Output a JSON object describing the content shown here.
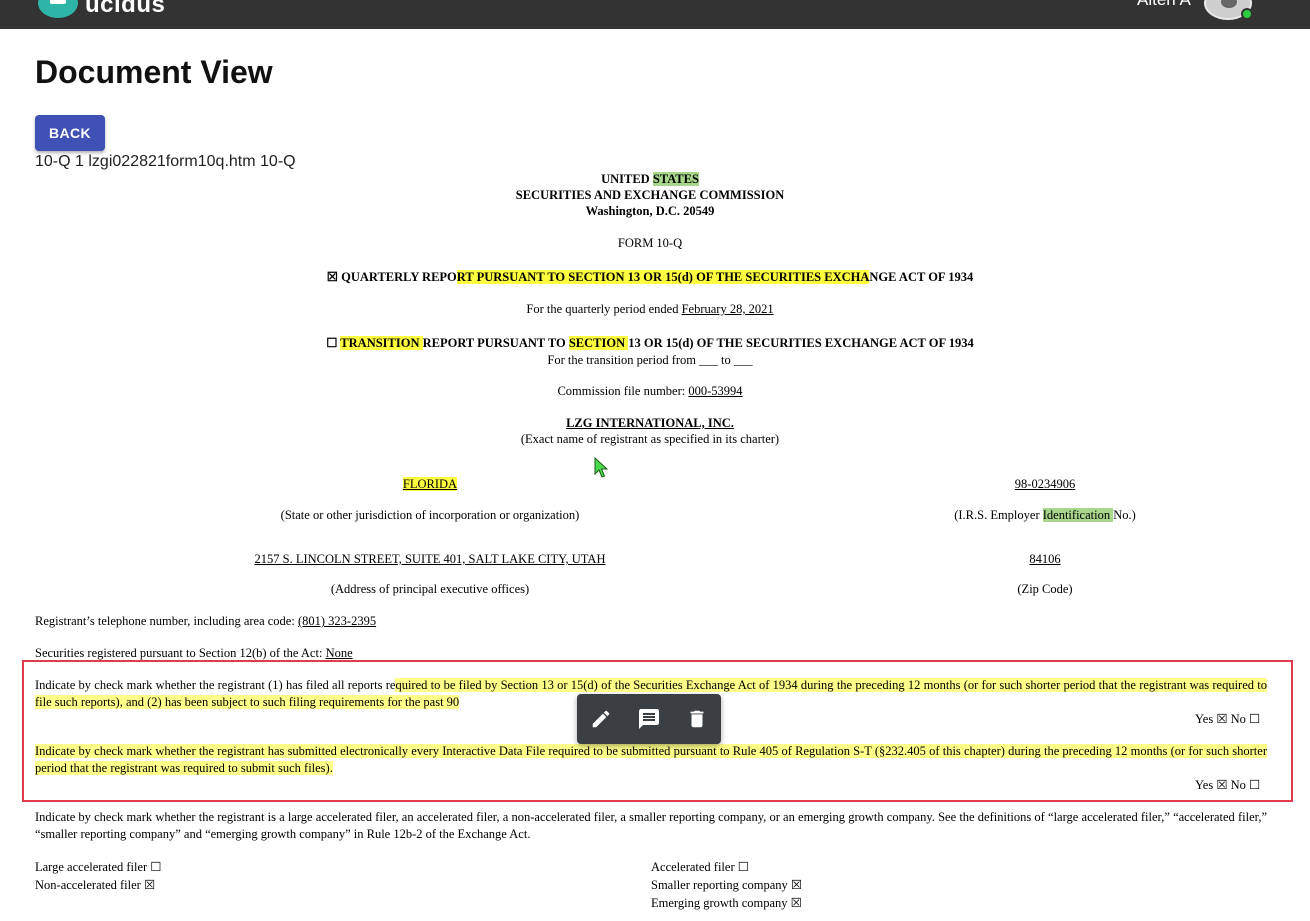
{
  "app": {
    "name": "ucidus",
    "user_name": "Aiten A"
  },
  "page": {
    "title": "Document View",
    "back_label": "BACK",
    "doc_heading": "10-Q 1 lzgi022821form10q.htm 10-Q"
  },
  "colors": {
    "appbar": "#333333",
    "accent": "#3f51b5",
    "highlight_yellow": "#ffff40",
    "highlight_green": "#a8d68b",
    "selection_border": "#e23b4e"
  },
  "document": {
    "header": {
      "line1_a": "UNITED ",
      "line1_b": "STATES",
      "line2": "SECURITIES AND EXCHANGE COMMISSION",
      "line3": "Washington, D.C. 20549"
    },
    "form": "FORM 10-Q",
    "quarterly": {
      "a": "☒ QUARTERLY REPO",
      "b": "RT PURSUANT TO SECTION 13 OR 15(d) OF THE SECURITIES EXCHA",
      "c": "NGE ACT OF 1934"
    },
    "period": {
      "label": "For the quarterly period ended ",
      "value": "February 28, 2021"
    },
    "transition": {
      "a": "☐ ",
      "b": "TRANSITION ",
      "c": "REPORT PURSUANT TO ",
      "d": "SECTION ",
      "e": "13 OR 15(d) OF THE SECURITIES EXCHANGE ACT OF 1934"
    },
    "transition_period": "For the transition period from ___ to ___",
    "commission": {
      "label": "Commission file number: ",
      "value": "000-53994"
    },
    "registrant": {
      "name": "LZG INTERNATIONAL, INC.",
      "sub": "(Exact name of registrant as specified in its charter)"
    },
    "state": {
      "value": "FLORIDA",
      "label": "(State or other jurisdiction of incorporation or organization)"
    },
    "irs": {
      "value": "98-0234906",
      "label_a": "(I.R.S. Employer ",
      "label_b": "Identification ",
      "label_c": "No.)"
    },
    "address": {
      "value": "2157 S. LINCOLN STREET, SUITE 401, SALT LAKE CITY, UTAH",
      "label": "(Address of principal executive offices)"
    },
    "zip": {
      "value": "84106",
      "label": "(Zip Code)"
    },
    "phone": {
      "label": "Registrant’s telephone number, including area code: ",
      "value": "(801) 323-2395"
    },
    "securities": {
      "label": "Securities registered pursuant to Section 12(b) of the Act: ",
      "value": "None"
    },
    "para1": {
      "a": "Indicate by check mark whether the registrant (1) has filed all reports re",
      "b": "quired to be filed by Section 13 or 15(d) of the Securities Exchange Act of 1934 during the preceding 12 months (or for such shorter period that the registrant was required to file such reports), and (2) has been subject to such filing requirements for the past 90",
      "yesno": "Yes ☒  No ☐"
    },
    "para2": {
      "text": "Indicate by check mark whether the registrant has submitted electronically every Interactive Data File required to be submitted pursuant to Rule 405 of Regulation S-T (§232.405 of this chapter) during the preceding 12 months (or for such shorter period that the registrant was required to submit such files).",
      "yesno": "Yes ☒  No ☐"
    },
    "para3": "Indicate by check mark whether the registrant is a large accelerated filer, an accelerated filer, a non-accelerated filer, a smaller reporting company, or an emerging growth company. See the definitions of “large accelerated filer,” “accelerated filer,” “smaller reporting company” and “emerging growth company” in Rule 12b-2 of the Exchange Act.",
    "filers": {
      "large": "Large accelerated filer ☐",
      "non_accelerated": "Non-accelerated filer ☒",
      "accelerated": "Accelerated filer ☐",
      "smaller": "Smaller reporting company ☒",
      "emerging": "Emerging growth company ☒"
    }
  },
  "toolbar": {
    "edit_icon": "pencil-icon",
    "comment_icon": "comment-icon",
    "delete_icon": "trash-icon"
  }
}
